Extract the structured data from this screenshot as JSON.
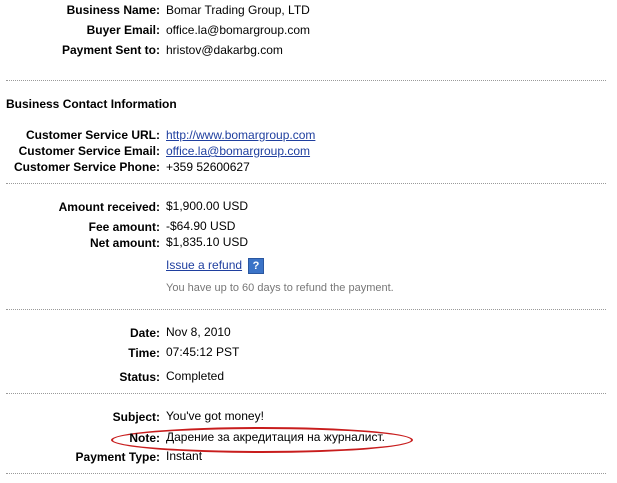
{
  "payment_info": {
    "business_name_label": "Business Name:",
    "business_name": "Bomar Trading Group, LTD",
    "buyer_email_label": "Buyer Email:",
    "buyer_email": "office.la@bomargroup.com",
    "payment_sent_to_label": "Payment Sent to:",
    "payment_sent_to": "hristov@dakarbg.com"
  },
  "business_contact": {
    "heading": "Business Contact Information",
    "service_url_label": "Customer Service URL:",
    "service_url": "http://www.bomargroup.com",
    "service_email_label": "Customer Service Email:",
    "service_email": "office.la@bomargroup.com",
    "service_phone_label": "Customer Service Phone:",
    "service_phone": "+359 52600627"
  },
  "amounts": {
    "received_label": "Amount received:",
    "received": "$1,900.00 USD",
    "fee_label": "Fee amount:",
    "fee": "-$64.90 USD",
    "net_label": "Net amount:",
    "net": "$1,835.10 USD",
    "refund_link": "Issue a refund",
    "help_icon": "?",
    "refund_hint": "You have up to 60 days to refund the payment."
  },
  "timing": {
    "date_label": "Date:",
    "date": "Nov 8, 2010",
    "time_label": "Time:",
    "time": "07:45:12 PST",
    "status_label": "Status:",
    "status": "Completed"
  },
  "message": {
    "subject_label": "Subject:",
    "subject": "You've got money!",
    "note_label": "Note:",
    "note": "Дарение за акредитация на журналист.",
    "payment_type_label": "Payment Type:",
    "payment_type": "Instant"
  },
  "colors": {
    "link": "#1f3f9f",
    "annotation": "#c81d1d",
    "hint": "#777777"
  }
}
